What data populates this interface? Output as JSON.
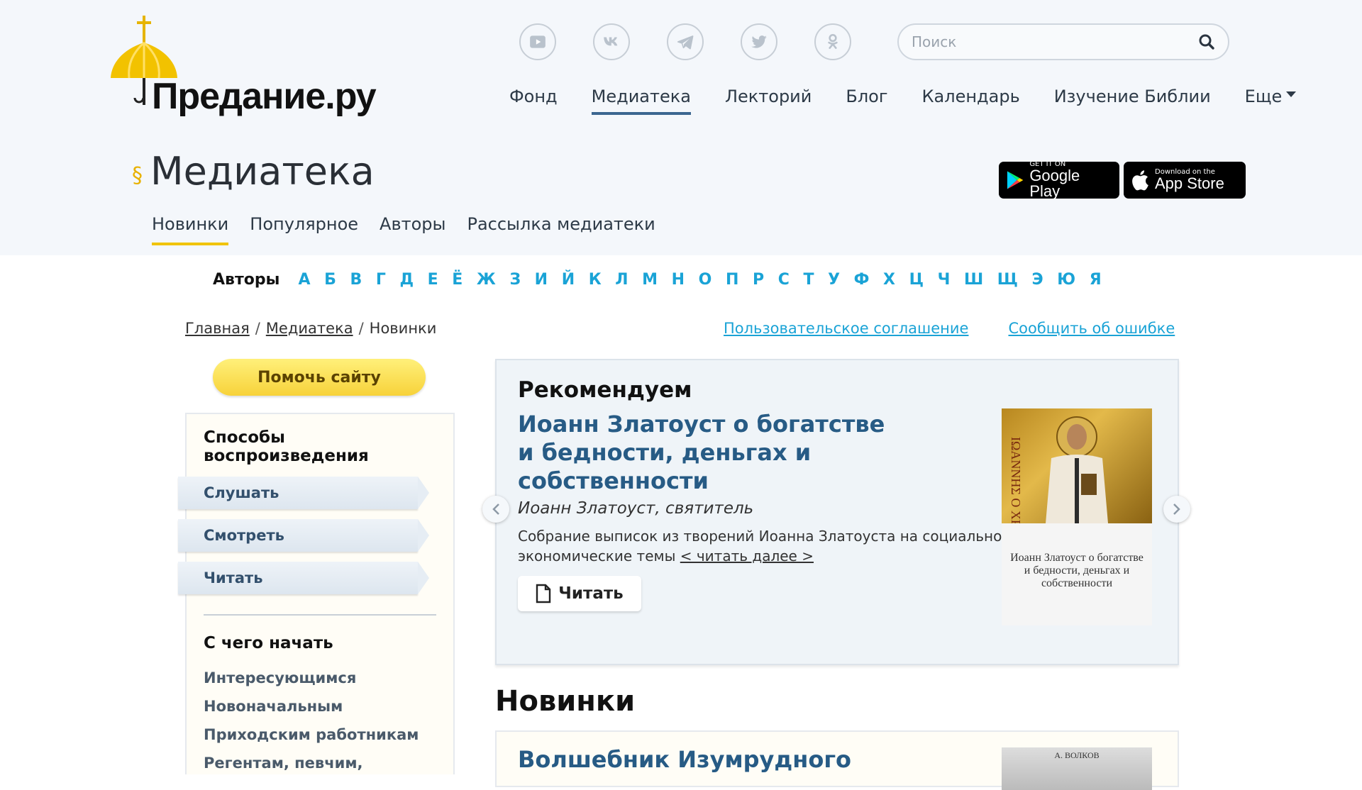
{
  "header": {
    "logo_text": "Предание.ру",
    "search_placeholder": "Поиск",
    "social": [
      "youtube-icon",
      "vk-icon",
      "telegram-icon",
      "twitter-icon",
      "odnoklassniki-icon"
    ],
    "nav": [
      {
        "label": "Фонд",
        "active": false
      },
      {
        "label": "Медиатека",
        "active": true
      },
      {
        "label": "Лекторий",
        "active": false
      },
      {
        "label": "Блог",
        "active": false
      },
      {
        "label": "Календарь",
        "active": false
      },
      {
        "label": "Изучение Библии",
        "active": false
      },
      {
        "label": "Еще",
        "active": false
      }
    ]
  },
  "page": {
    "section_mark": "§",
    "title": "Медиатека",
    "stores": {
      "google": {
        "small": "GET IT ON",
        "big": "Google Play"
      },
      "apple": {
        "small": "Download on the",
        "big": "App Store"
      }
    },
    "tabs": [
      "Новинки",
      "Популярное",
      "Авторы",
      "Рассылка медиатеки"
    ]
  },
  "alphabet": {
    "label": "Авторы",
    "letters": [
      "А",
      "Б",
      "В",
      "Г",
      "Д",
      "Е",
      "Ё",
      "Ж",
      "З",
      "И",
      "Й",
      "К",
      "Л",
      "М",
      "Н",
      "О",
      "П",
      "Р",
      "С",
      "Т",
      "У",
      "Ф",
      "Х",
      "Ц",
      "Ч",
      "Ш",
      "Щ",
      "Э",
      "Ю",
      "Я"
    ]
  },
  "breadcrumbs": {
    "home": "Главная",
    "media": "Медиатека",
    "current": "Новинки",
    "sep": "/"
  },
  "links": {
    "agreement": "Пользовательское соглашение",
    "report": "Сообщить об ошибке"
  },
  "donate": "Помочь сайту",
  "sidebar": {
    "modes_title": "Способы воспроизведения",
    "modes": [
      "Слушать",
      "Смотреть",
      "Читать"
    ],
    "start_title": "С чего начать",
    "start_links": [
      "Интересующимся",
      "Новоначальным",
      "Приходским работникам",
      "Регентам, певчим,"
    ]
  },
  "recommend": {
    "label": "Рекомендуем",
    "title": "Иоанн Златоуст о богатстве и бедности, деньгах и собственности",
    "author": "Иоанн Златоуст, святитель",
    "description": "Собрание выписок из творений Иоанна Златоуста на социально-экономические темы",
    "read_more": "< читать далее >",
    "read_button": "Читать",
    "cover_text": "Иоанн Златоуст о богатстве и бедности, деньгах и собственности",
    "cover_mosaic_text": "ΙΩΑΝΝΗΣ Ο ΧΡΥΣΟΣΤΟΜΟΣ"
  },
  "news": {
    "title": "Новинки",
    "first_item_title": "Волшебник Изумрудного",
    "first_cover_text": "А. ВОЛКОВ"
  }
}
